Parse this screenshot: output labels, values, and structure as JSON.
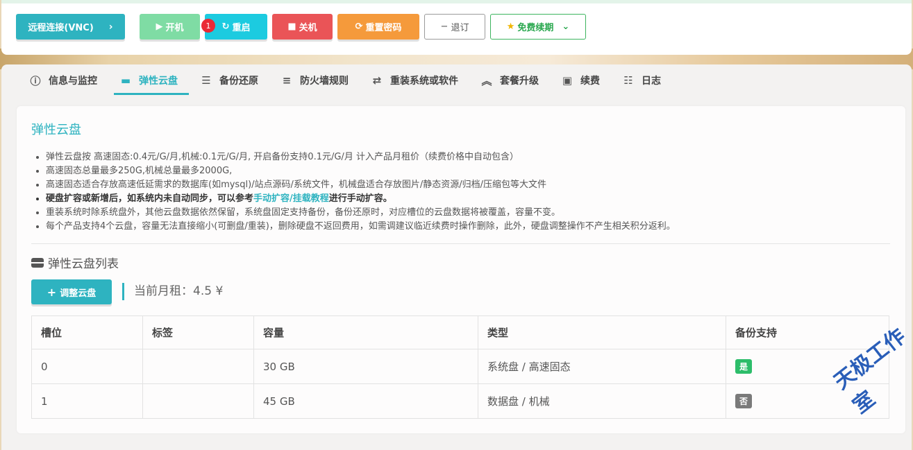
{
  "toolbar": {
    "vnc_label": "远程连接(VNC)",
    "power_on_label": "开机",
    "restart_label": "重启",
    "restart_badge": "1",
    "power_off_label": "关机",
    "reset_password_label": "重置密码",
    "refund_label": "退订",
    "free_renew_label": "免费续期"
  },
  "tabs": [
    {
      "label": "信息与监控",
      "icon": "info-icon"
    },
    {
      "label": "弹性云盘",
      "icon": "disk-icon",
      "active": true
    },
    {
      "label": "备份还原",
      "icon": "server-icon"
    },
    {
      "label": "防火墙规则",
      "icon": "list-icon"
    },
    {
      "label": "重装系统或软件",
      "icon": "exchange-icon"
    },
    {
      "label": "套餐升级",
      "icon": "upgrade-icon"
    },
    {
      "label": "续费",
      "icon": "money-icon"
    },
    {
      "label": "日志",
      "icon": "log-icon"
    }
  ],
  "panel": {
    "title": "弹性云盘",
    "notes": {
      "n1": "弹性云盘按 高速固态:0.4元/G/月,机械:0.1元/G/月, 开启备份支持0.1元/G/月 计入产品月租价（续费价格中自动包含）",
      "n2": "高速固态总量最多250G,机械总量最多2000G,",
      "n3": "高速固态适合存放高速低延需求的数据库(如mysql)/站点源码/系统文件，机械盘适合存放图片/静态资源/归档/压缩包等大文件",
      "n4_pre": "硬盘扩容或新增后，如系统内未自动同步，可以参考",
      "n4_link": "手动扩容/挂载教程",
      "n4_post": "进行手动扩容。",
      "n5": "重装系统时除系统盘外，其他云盘数据依然保留，系统盘固定支持备份，备份还原时，对应槽位的云盘数据将被覆盖，容量不变。",
      "n6": "每个产品支持4个云盘，容量无法直接缩小(可删盘/重装)，删除硬盘不返回费用，如需调建议临近续费时操作删除，此外，硬盘调整操作不产生相关积分返利。"
    },
    "list_title": "弹性云盘列表",
    "adjust_label": "调整云盘",
    "monthly_text": "当前月租：4.5 ¥"
  },
  "table": {
    "headers": {
      "slot": "槽位",
      "label": "标签",
      "capacity": "容量",
      "type": "类型",
      "backup": "备份支持"
    },
    "rows": [
      {
        "slot": "0",
        "label": "",
        "capacity": "30 GB",
        "type": "系统盘 / 高速固态",
        "backup": "是"
      },
      {
        "slot": "1",
        "label": "",
        "capacity": "45 GB",
        "type": "数据盘 / 机械",
        "backup": "否"
      }
    ]
  },
  "watermark": "天极工作室"
}
